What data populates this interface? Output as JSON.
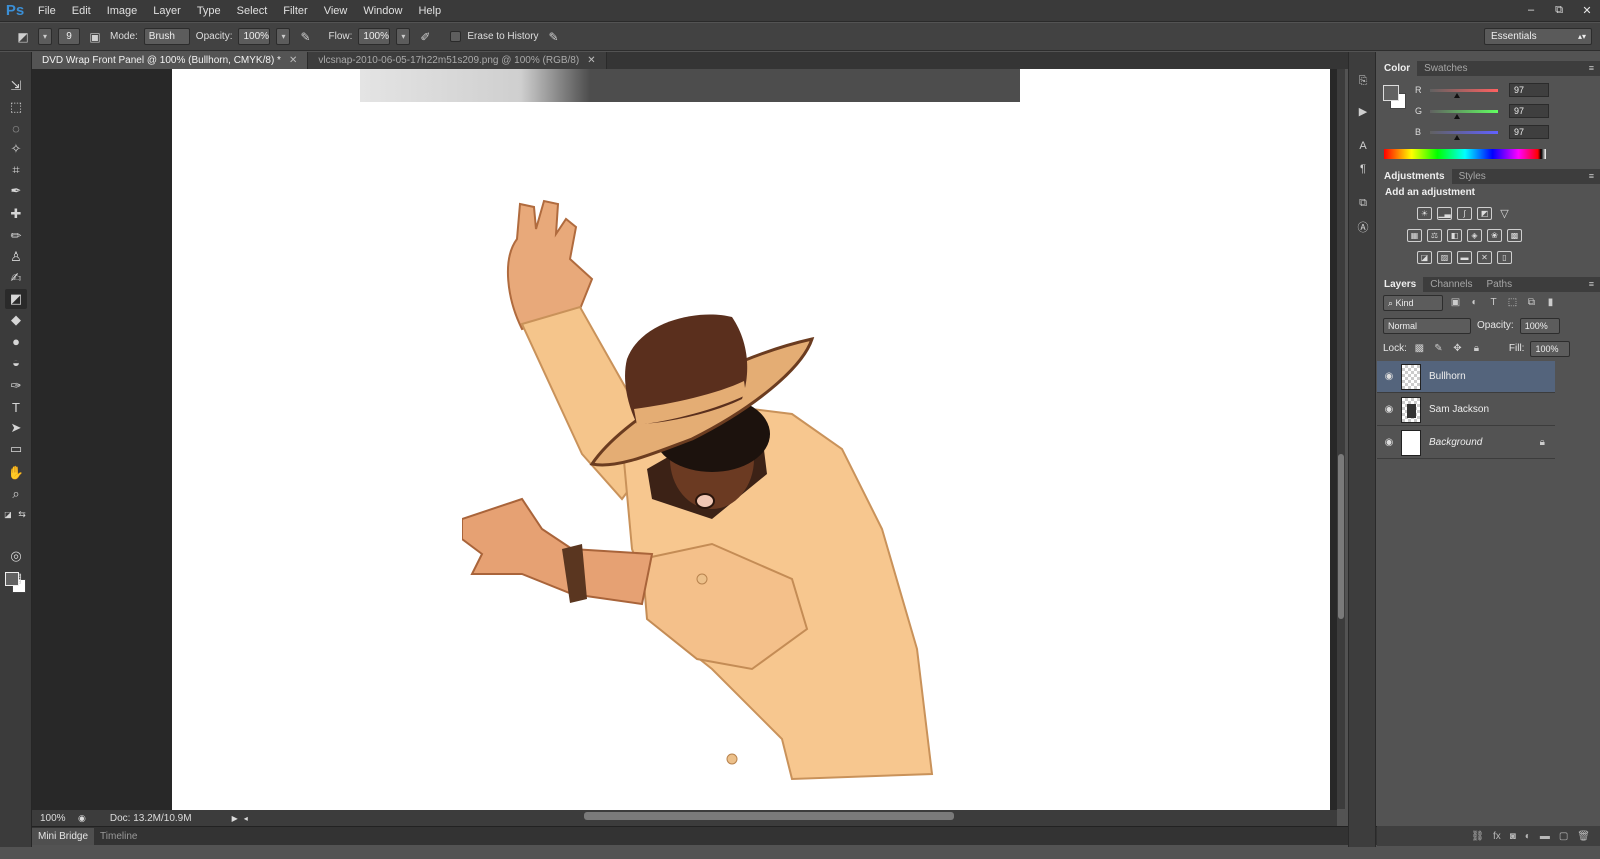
{
  "app": {
    "logo": "Ps",
    "menu": [
      "File",
      "Edit",
      "Image",
      "Layer",
      "Type",
      "Select",
      "Filter",
      "View",
      "Window",
      "Help"
    ],
    "window_controls": [
      "–",
      "⧉",
      "✕"
    ]
  },
  "options_bar": {
    "brush_size": "9",
    "mode_label": "Mode:",
    "mode_value": "Brush",
    "opacity_label": "Opacity:",
    "opacity_value": "100%",
    "flow_label": "Flow:",
    "flow_value": "100%",
    "erase_history_label": "Erase to History",
    "workspace": "Essentials"
  },
  "tabs": [
    {
      "label": "DVD Wrap Front Panel @ 100% (Bullhorn, CMYK/8) *",
      "active": true
    },
    {
      "label": "vlcsnap-2010-06-05-17h22m51s209.png @ 100% (RGB/8)",
      "active": false
    }
  ],
  "status": {
    "zoom": "100%",
    "doc": "Doc: 13.2M/10.9M"
  },
  "bottom_tabs": [
    "Mini Bridge",
    "Timeline"
  ],
  "color_panel": {
    "tabs": [
      "Color",
      "Swatches"
    ],
    "sliders": [
      {
        "channel": "R",
        "value": "97",
        "gradient": [
          "#616161",
          "#ff6161"
        ]
      },
      {
        "channel": "G",
        "value": "97",
        "gradient": [
          "#616161",
          "#61ff61"
        ]
      },
      {
        "channel": "B",
        "value": "97",
        "gradient": [
          "#616161",
          "#6161ff"
        ]
      }
    ],
    "foreground": "#616161",
    "background": "#ffffff"
  },
  "adjustments_panel": {
    "tabs": [
      "Adjustments",
      "Styles"
    ],
    "heading": "Add an adjustment"
  },
  "layers_panel": {
    "tabs": [
      "Layers",
      "Channels",
      "Paths"
    ],
    "filter": "Kind",
    "blend_mode": "Normal",
    "opacity_label": "Opacity:",
    "opacity_value": "100%",
    "lock_label": "Lock:",
    "fill_label": "Fill:",
    "fill_value": "100%",
    "layers": [
      {
        "name": "Bullhorn",
        "selected": true
      },
      {
        "name": "Sam Jackson",
        "selected": false
      },
      {
        "name": "Background",
        "selected": false,
        "locked": true
      }
    ]
  }
}
